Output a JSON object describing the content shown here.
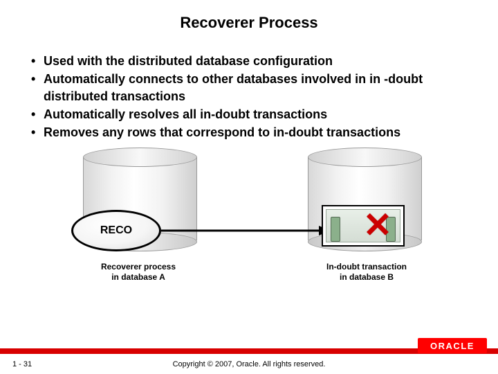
{
  "title": "Recoverer Process",
  "bullets": [
    "Used with the distributed database configuration",
    "Automatically connects to other databases involved in in -doubt distributed transactions",
    "Automatically resolves all in-doubt transactions",
    "Removes any rows that correspond to in-doubt transactions"
  ],
  "diagram": {
    "reco_label": "RECO",
    "fail_mark": "✕",
    "caption_a_line1": "Recoverer process",
    "caption_a_line2": "in database A",
    "caption_b_line1": "In-doubt transaction",
    "caption_b_line2": "in database B"
  },
  "footer": {
    "page": "1 - 31",
    "copyright": "Copyright © 2007, Oracle. All rights reserved.",
    "logo_text": "ORACLE"
  }
}
